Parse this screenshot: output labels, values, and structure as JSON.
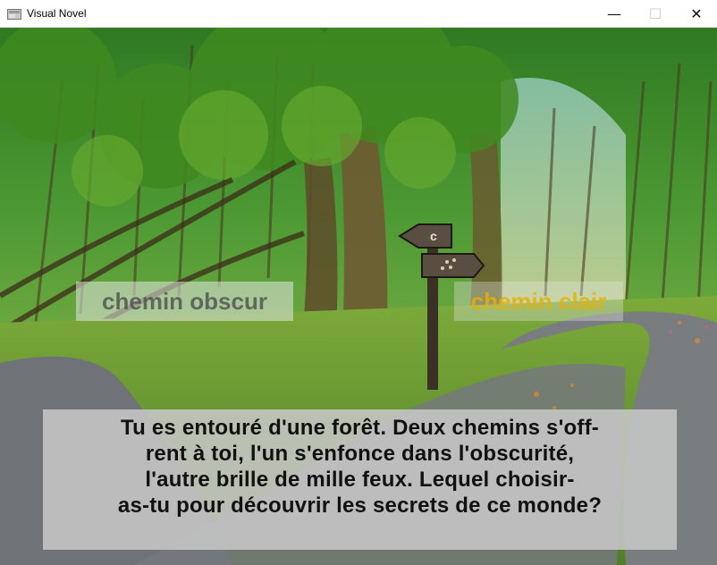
{
  "window": {
    "title": "Visual Novel",
    "icon": "app-icon",
    "controls": {
      "minimize": "—",
      "maximize": "☐",
      "close": "✕"
    }
  },
  "scene": {
    "background": "forest-path-illustration",
    "choices": [
      {
        "label": "chemin obscur",
        "color": "#46484a"
      },
      {
        "label": "chemin clair",
        "color": "#e8b000"
      }
    ],
    "dialog": {
      "text": "Tu es entouré d'une forêt. Deux chemins s'off-\nrent à toi, l'un s'enfonce dans l'obscurité,\nl'autre brille de mille feux.  Lequel choisir-\nas-tu pour découvrir les secrets de ce monde?"
    }
  },
  "colors": {
    "foliage": "#5a9e2a",
    "path": "#777a7e",
    "dialog_box": "#c8c8c8"
  }
}
